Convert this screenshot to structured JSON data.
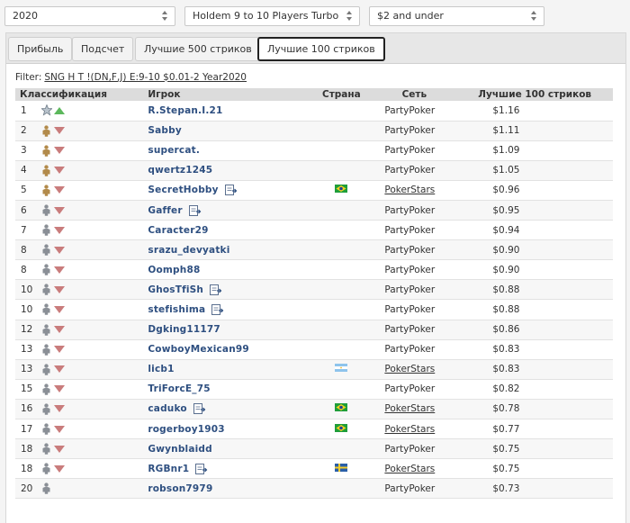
{
  "filters": {
    "year": "2020",
    "game": "Holdem 9 to 10 Players Turbo",
    "stakes": "$2 and under"
  },
  "tabs": [
    "Прибыль",
    "Подсчет",
    "Лучшие 500 стриков",
    "Лучшие 100 стриков"
  ],
  "active_tab": 3,
  "filter_label": "Filter:",
  "filter_value": "SNG H T !(DN,F,J) E:9-10 $0.01-2 Year2020",
  "columns": {
    "classification": "Классификация",
    "player": "Игрок",
    "country": "Страна",
    "network": "Сеть",
    "top100": "Лучшие 100 стриков"
  },
  "colors": {
    "name": "#2e4f80",
    "up": "#5cb85c",
    "down": "#c97c7c",
    "gold": "#b28a4a",
    "grey": "#8a8f96"
  },
  "rows": [
    {
      "rank": "1",
      "badge": "star",
      "trend": "up",
      "player": "R.Stepan.I.21",
      "note": false,
      "flag": "",
      "network": "PartyPoker",
      "net_link": false,
      "value": "$1.16"
    },
    {
      "rank": "2",
      "badge": "gold",
      "trend": "down",
      "player": "Sabby",
      "note": false,
      "flag": "",
      "network": "PartyPoker",
      "net_link": false,
      "value": "$1.11"
    },
    {
      "rank": "3",
      "badge": "gold",
      "trend": "down",
      "player": "supercat.",
      "note": false,
      "flag": "",
      "network": "PartyPoker",
      "net_link": false,
      "value": "$1.09"
    },
    {
      "rank": "4",
      "badge": "gold",
      "trend": "down",
      "player": "qwertz1245",
      "note": false,
      "flag": "",
      "network": "PartyPoker",
      "net_link": false,
      "value": "$1.05"
    },
    {
      "rank": "5",
      "badge": "gold",
      "trend": "down",
      "player": "SecretHobby",
      "note": true,
      "flag": "brazil",
      "network": "PokerStars",
      "net_link": true,
      "value": "$0.96"
    },
    {
      "rank": "6",
      "badge": "grey",
      "trend": "down",
      "player": "Gaffer",
      "note": true,
      "flag": "",
      "network": "PartyPoker",
      "net_link": false,
      "value": "$0.95"
    },
    {
      "rank": "7",
      "badge": "grey",
      "trend": "down",
      "player": "Caracter29",
      "note": false,
      "flag": "",
      "network": "PartyPoker",
      "net_link": false,
      "value": "$0.94"
    },
    {
      "rank": "8",
      "badge": "grey",
      "trend": "down",
      "player": "srazu_devyatki",
      "note": false,
      "flag": "",
      "network": "PartyPoker",
      "net_link": false,
      "value": "$0.90"
    },
    {
      "rank": "8",
      "badge": "grey",
      "trend": "down",
      "player": "Oomph88",
      "note": false,
      "flag": "",
      "network": "PartyPoker",
      "net_link": false,
      "value": "$0.90"
    },
    {
      "rank": "10",
      "badge": "grey",
      "trend": "down",
      "player": "GhosTfiSh",
      "note": true,
      "flag": "",
      "network": "PartyPoker",
      "net_link": false,
      "value": "$0.88"
    },
    {
      "rank": "10",
      "badge": "grey",
      "trend": "down",
      "player": "stefishima",
      "note": true,
      "flag": "",
      "network": "PartyPoker",
      "net_link": false,
      "value": "$0.88"
    },
    {
      "rank": "12",
      "badge": "grey",
      "trend": "down",
      "player": "Dgking11177",
      "note": false,
      "flag": "",
      "network": "PartyPoker",
      "net_link": false,
      "value": "$0.86"
    },
    {
      "rank": "13",
      "badge": "grey",
      "trend": "down",
      "player": "CowboyMexican99",
      "note": false,
      "flag": "",
      "network": "PartyPoker",
      "net_link": false,
      "value": "$0.83"
    },
    {
      "rank": "13",
      "badge": "grey",
      "trend": "down",
      "player": "licb1",
      "note": false,
      "flag": "argentina",
      "network": "PokerStars",
      "net_link": true,
      "value": "$0.83"
    },
    {
      "rank": "15",
      "badge": "grey",
      "trend": "down",
      "player": "TriForcE_75",
      "note": false,
      "flag": "",
      "network": "PartyPoker",
      "net_link": false,
      "value": "$0.82"
    },
    {
      "rank": "16",
      "badge": "grey",
      "trend": "down",
      "player": "caduko",
      "note": true,
      "flag": "brazil",
      "network": "PokerStars",
      "net_link": true,
      "value": "$0.78"
    },
    {
      "rank": "17",
      "badge": "grey",
      "trend": "down",
      "player": "rogerboy1903",
      "note": false,
      "flag": "brazil",
      "network": "PokerStars",
      "net_link": true,
      "value": "$0.77"
    },
    {
      "rank": "18",
      "badge": "grey",
      "trend": "down",
      "player": "Gwynblaidd",
      "note": false,
      "flag": "",
      "network": "PartyPoker",
      "net_link": false,
      "value": "$0.75"
    },
    {
      "rank": "18",
      "badge": "grey",
      "trend": "down",
      "player": "RGBnr1",
      "note": true,
      "flag": "sweden",
      "network": "PokerStars",
      "net_link": true,
      "value": "$0.75"
    },
    {
      "rank": "20",
      "badge": "grey",
      "trend": "",
      "player": "robson7979",
      "note": false,
      "flag": "",
      "network": "PartyPoker",
      "net_link": false,
      "value": "$0.73"
    }
  ]
}
